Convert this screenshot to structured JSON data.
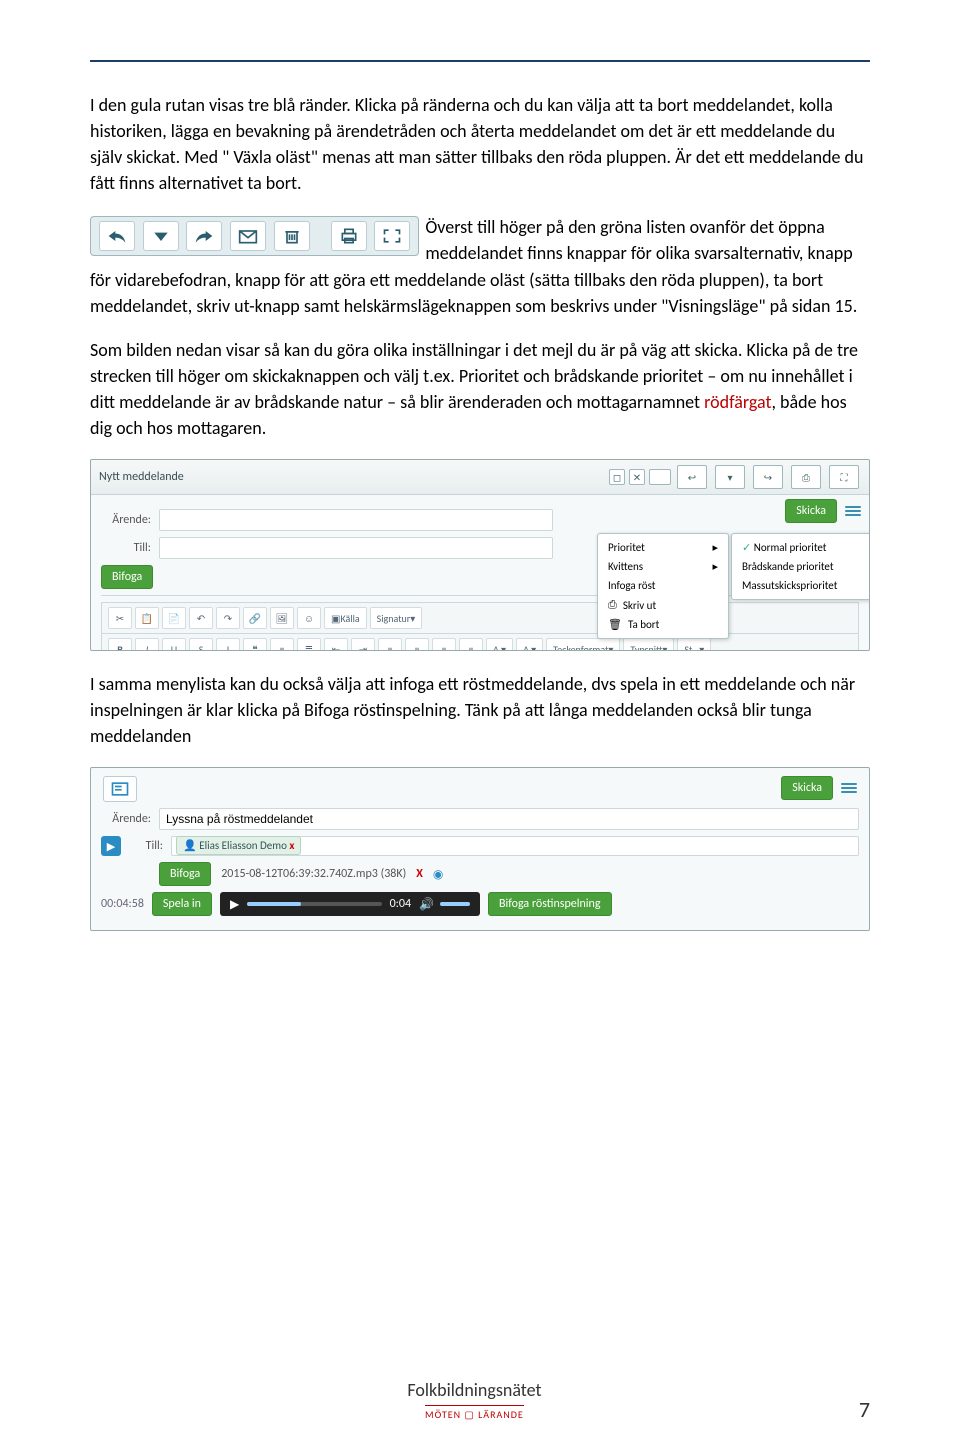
{
  "paragraphs": {
    "p1a": "I den gula rutan visas tre blå ränder. Klicka på ränderna och du kan välja att ta bort meddelandet, kolla historiken, lägga en bevakning på ärendetråden och återta meddelandet om det är ett meddelande du själv skickat. Med \" Växla oläst\" menas att man sätter tillbaks den röda pluppen. Är det ett meddelande du fått finns alternativet ta bort.",
    "p1b": "Överst till höger på den gröna listen ovanför det öppna meddelandet finns knappar för olika svarsalternativ, knapp för vidarebefodran, knapp för att göra ett meddelande oläst (sätta tillbaks den röda pluppen), ta bort meddelandet, skriv ut-knapp samt helskärmslägeknappen som beskrivs under \"Visningsläge\" på sidan 15.",
    "p2a": "Som bilden nedan visar så kan du göra olika inställningar i det mejl du är på väg att skicka. Klicka på de tre strecken till höger om skickaknappen och välj t.ex. Prioritet och brådskande prioritet – om nu innehållet i ditt meddelande är av brådskande natur – så blir ärenderaden och mottagarnamnet ",
    "p2b_red": "rödfärgat",
    "p2c": ", både hos dig och hos mottagaren.",
    "p3": "I samma menylista kan du också välja att infoga ett röstmeddelande, dvs spela in ett meddelande och när inspelningen är klar klicka på Bifoga röstinspelning. Tänk på att långa meddelanden också blir tunga meddelanden"
  },
  "screenshot1": {
    "title": "Nytt meddelande",
    "label_subject": "Ärende:",
    "label_to": "Till:",
    "btn_send": "Skicka",
    "btn_attach": "Bifoga",
    "menu": {
      "priority": "Prioritet",
      "receipt": "Kvittens",
      "voice": "Infoga röst",
      "print": "Skriv ut",
      "delete": "Ta bort"
    },
    "submenu": {
      "normal": "Normal prioritet",
      "urgent": "Brådskande prioritet",
      "mass": "Massutskicksprioritet"
    },
    "rt": {
      "source": "Källa",
      "sign": "Signatur",
      "fmt": "Teckenformat",
      "font": "Typsnitt",
      "size": "St…"
    }
  },
  "screenshot2": {
    "label_subject": "Ärende:",
    "subject_value": "Lyssna på röstmeddelandet",
    "label_to": "Till:",
    "to_value": "Elias Eliasson Demo",
    "btn_send": "Skicka",
    "btn_attach": "Bifoga",
    "attachment": "2015-08-12T06:39:32.740Z.mp3 (38K)",
    "btn_record": "Spela in",
    "btn_attach_voice": "Bifoga röstinspelning",
    "time_total": "00:04:58",
    "time_cur": "0:04"
  },
  "footer": {
    "brand": "Folkbildningsnätet",
    "tag": "MÖTEN ▢ LÄRANDE",
    "page": "7"
  }
}
